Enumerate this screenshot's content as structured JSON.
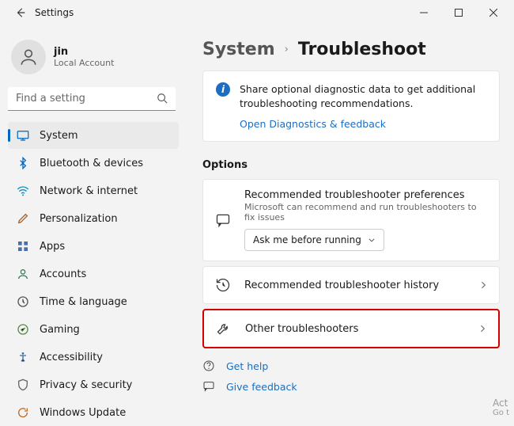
{
  "app": {
    "title": "Settings"
  },
  "account": {
    "name": "jin",
    "type": "Local Account"
  },
  "search": {
    "placeholder": "Find a setting"
  },
  "sidebar": {
    "items": [
      {
        "label": "System"
      },
      {
        "label": "Bluetooth & devices"
      },
      {
        "label": "Network & internet"
      },
      {
        "label": "Personalization"
      },
      {
        "label": "Apps"
      },
      {
        "label": "Accounts"
      },
      {
        "label": "Time & language"
      },
      {
        "label": "Gaming"
      },
      {
        "label": "Accessibility"
      },
      {
        "label": "Privacy & security"
      },
      {
        "label": "Windows Update"
      }
    ]
  },
  "breadcrumb": {
    "parent": "System",
    "sep": "›",
    "current": "Troubleshoot"
  },
  "banner": {
    "text": "Share optional diagnostic data to get additional troubleshooting recommendations.",
    "link": "Open Diagnostics & feedback"
  },
  "options": {
    "heading": "Options",
    "pref": {
      "title": "Recommended troubleshooter preferences",
      "sub": "Microsoft can recommend and run troubleshooters to fix issues",
      "dropdown_value": "Ask me before running"
    },
    "history": {
      "title": "Recommended troubleshooter history"
    },
    "other": {
      "title": "Other troubleshooters"
    }
  },
  "footer": {
    "help": "Get help",
    "feedback": "Give feedback"
  },
  "watermark": {
    "line1": "Act",
    "line2": "Go t"
  }
}
